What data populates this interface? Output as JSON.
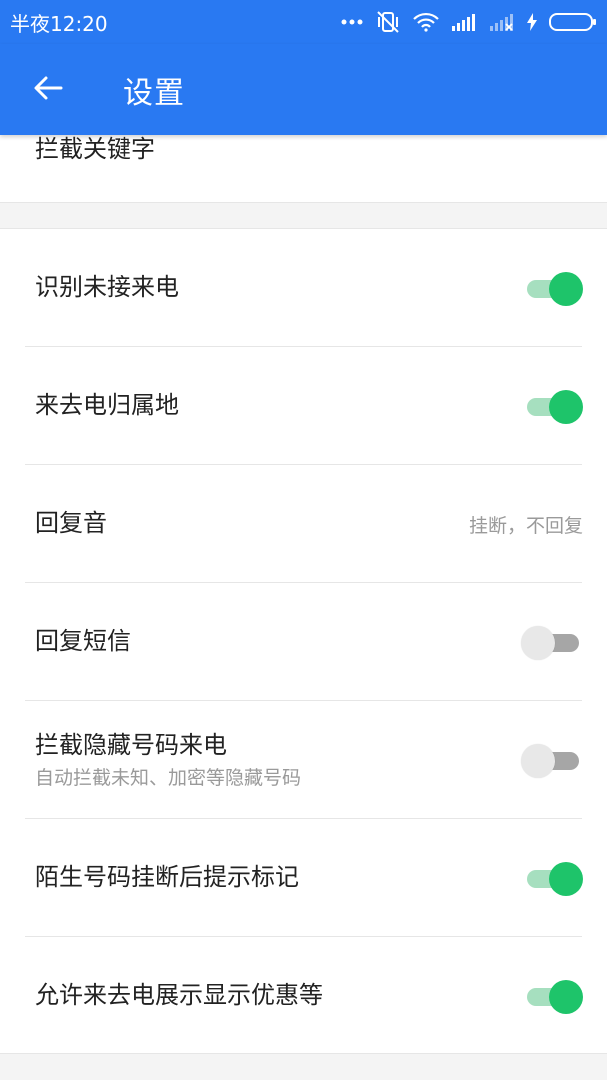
{
  "status_bar": {
    "time": "半夜12:20",
    "icons": [
      "more-dots-icon",
      "vibrate-off-icon",
      "wifi-icon",
      "signal-icon",
      "signal-off-icon",
      "charging-icon",
      "battery-icon"
    ]
  },
  "app_bar": {
    "back_icon": "arrow-left-icon",
    "title": "设置"
  },
  "top_section": {
    "partial_item": "拦截关键字"
  },
  "settings": [
    {
      "label": "识别未接来电",
      "type": "toggle",
      "on": true
    },
    {
      "label": "来去电归属地",
      "type": "toggle",
      "on": true
    },
    {
      "label": "回复音",
      "type": "value",
      "value": "挂断，不回复"
    },
    {
      "label": "回复短信",
      "type": "toggle",
      "on": false
    },
    {
      "label": "拦截隐藏号码来电",
      "sub": "自动拦截未知、加密等隐藏号码",
      "type": "toggle",
      "on": false
    },
    {
      "label": "陌生号码挂断后提示标记",
      "type": "toggle",
      "on": true
    },
    {
      "label": "允许来去电展示显示优惠等",
      "type": "toggle",
      "on": true
    }
  ],
  "colors": {
    "primary": "#2979f2",
    "toggle_on": "#1ec46a",
    "toggle_on_track": "#a6dfbf",
    "toggle_off_thumb": "#e8e8e8",
    "toggle_off_track": "#a6a6a6"
  }
}
